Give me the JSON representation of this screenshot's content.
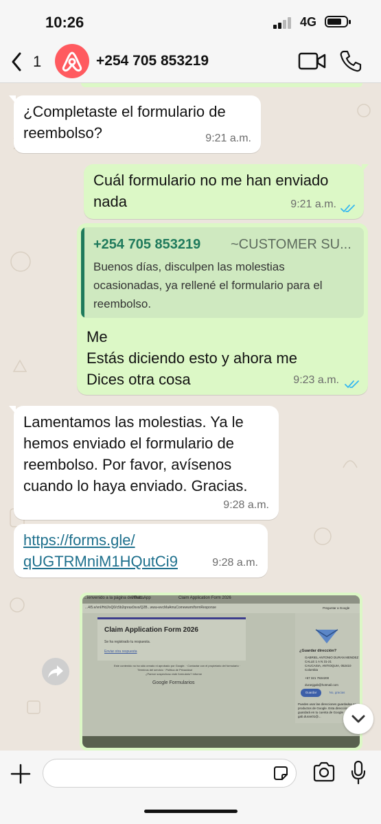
{
  "status": {
    "time": "10:26",
    "network": "4G",
    "battery_level": 0.75
  },
  "header": {
    "back_count": "1",
    "contact": "+254 705 853219",
    "avatar_icon": "airbnb-logo-icon"
  },
  "messages": [
    {
      "direction": "in",
      "text": "¿Completaste el formulario de\nreembolso?",
      "time": "9:21 a.m."
    },
    {
      "direction": "out",
      "text": "Cuál formulario no me han enviado\nnada",
      "time": "9:21 a.m.",
      "read": true
    },
    {
      "direction": "out",
      "quote_author": "+254 705 853219",
      "quote_tag": "~CUSTOMER SU...",
      "quote_text": "Buenos días, disculpen las molestias ocasionadas, ya rellené el formulario para el reembolso.",
      "text": "Me\nEstás diciendo esto y ahora me\nDices otra cosa",
      "time": "9:23 a.m.",
      "read": true
    },
    {
      "direction": "in",
      "text": "Lamentamos las molestias. Ya le\nhemos enviado el formulario de\nreembolso. Por favor, avísenos\ncuando lo haya enviado. Gracias.",
      "time": "9:28 a.m."
    },
    {
      "direction": "in",
      "text": "https://forms.gle/\nqUGTRMniM1HQutCi9",
      "time": "9:28 a.m.",
      "is_link": true
    }
  ],
  "photo": {
    "tabs": [
      "...ienvenido a la página del Sub...",
      "WhatsApp",
      "Claim Application Form 2026"
    ],
    "url": "...4/5.e/vnI/HdJ/xQ0/c5b2qnrax0svs/Q2B...wwa-wvcMaAmuComewwm/formResponse",
    "form_title": "Claim Application Form 2026",
    "form_sub": "Se ha registrado tu respuesta.",
    "form_link": "Enviar otra respuesta",
    "disclaimer": [
      "Este contenido no ha sido creado ni aprobado por Google. · Contactar con el propietario del formulario ·",
      "Términos del servicio · Política de Privacidad",
      "¿Parece sospechoso este formulario? Informe"
    ],
    "brand": "Google Formularios",
    "side_title": "¿Guardar dirección?",
    "side_lines": [
      "GABRIEL ANTONIO DURAN MENDEZ",
      "CALLE 1 A N 31-21",
      "CAUCASIA, ANTIOQUIA, 052410",
      "Colombia",
      "+57 321 7824200",
      "duranjgab@hotmail.com"
    ],
    "save_label": "Guardar",
    "no_label": "No, gracias",
    "side_note": "Puedes usar las direcciones guardadas en productos de Google. Esta dirección se guardará en tu cuenta de Google gab.duran01@...",
    "google_link": "Preguntar a Google"
  },
  "input": {
    "placeholder": ""
  },
  "colors": {
    "outgoing": "#dcf8c6",
    "incoming": "#ffffff",
    "read_ticks": "#34b7f1",
    "quote_accent": "#1f7a5c",
    "link": "#1d6f8c"
  }
}
